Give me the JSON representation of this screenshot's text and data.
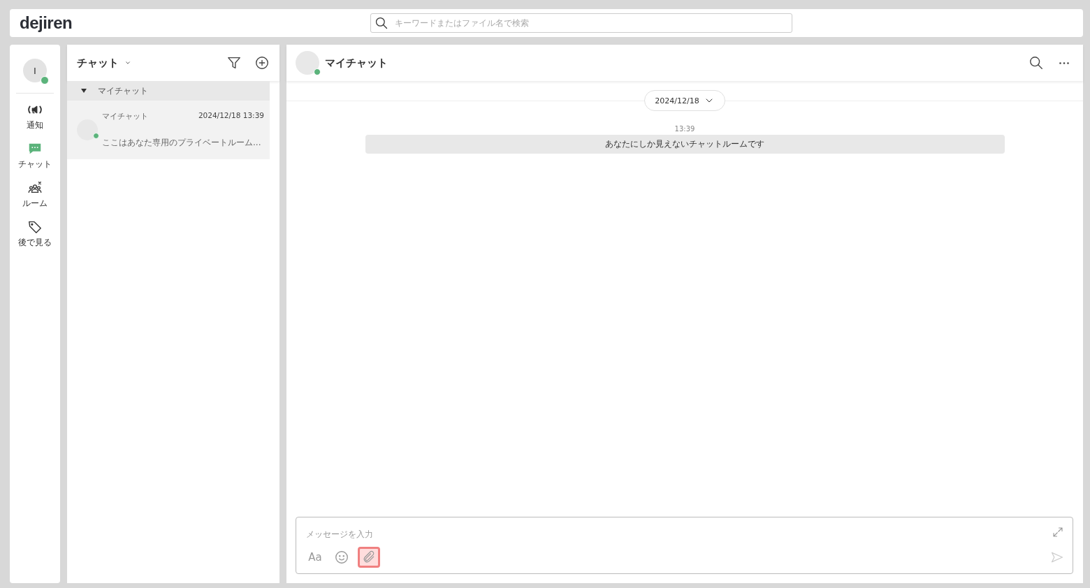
{
  "header": {
    "logo": "dejiren",
    "search": {
      "placeholder": "キーワードまたはファイル名で検索"
    }
  },
  "sidebar": {
    "user": {
      "initial": "I",
      "online": true
    },
    "items": [
      {
        "kind": "notify",
        "label": "通知",
        "selected": false
      },
      {
        "kind": "chat",
        "label": "チャット",
        "selected": true
      },
      {
        "kind": "room",
        "label": "ルーム",
        "selected": false
      },
      {
        "kind": "later",
        "label": "後で見る",
        "selected": false
      }
    ]
  },
  "chat_list": {
    "title": "チャット",
    "groups": [
      {
        "label": "マイチャット",
        "expanded": true,
        "items": [
          {
            "name": "マイチャット",
            "time": "2024/12/18 13:39",
            "preview": "ここはあなた専用のプライベートルーム...",
            "online": true,
            "selected": true
          }
        ]
      }
    ]
  },
  "conversation": {
    "title": "マイチャット",
    "online": true,
    "date": "2024/12/18",
    "messages": [
      {
        "time": "13:39",
        "text": "あなたにしか見えないチャットルームです"
      }
    ]
  },
  "composer": {
    "placeholder": "メッセージを入力",
    "tools": [
      {
        "kind": "format",
        "label": "Aa",
        "highlighted": false
      },
      {
        "kind": "emoji",
        "highlighted": false
      },
      {
        "kind": "attach",
        "highlighted": true
      }
    ]
  }
}
